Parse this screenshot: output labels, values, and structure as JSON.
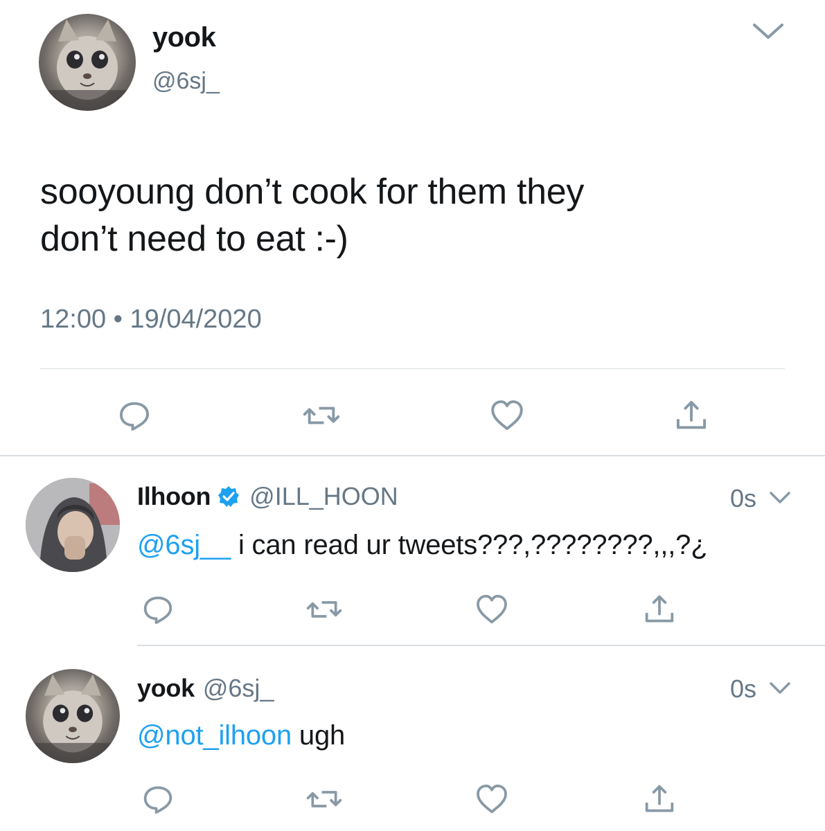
{
  "main_tweet": {
    "author_name": "yook",
    "author_handle": "@6sj_",
    "text_line1": "sooyoung don’t cook for them they",
    "text_line2": "don’t need to eat :-)",
    "timestamp": "12:00 • 19/04/2020",
    "avatar_icon": "cat-avatar"
  },
  "replies": [
    {
      "author_name": "Ilhoon",
      "verified": true,
      "author_handle": "@ILL_HOON",
      "time": "0s",
      "mention": "@6sj__",
      "text": " i can read ur tweets???,????????,,,?¿",
      "avatar_icon": "hoodie-avatar"
    },
    {
      "author_name": "yook",
      "verified": false,
      "author_handle": "@6sj_",
      "time": "0s",
      "mention": "@not_ilhoon",
      "text": " ugh",
      "avatar_icon": "cat-avatar"
    }
  ],
  "actions": [
    "reply-icon",
    "retweet-icon",
    "like-icon",
    "share-icon"
  ],
  "colors": {
    "text": "#14171a",
    "secondary": "#657786",
    "icon": "#8899a6",
    "link": "#1da1f2",
    "divider": "#d8dde1"
  }
}
